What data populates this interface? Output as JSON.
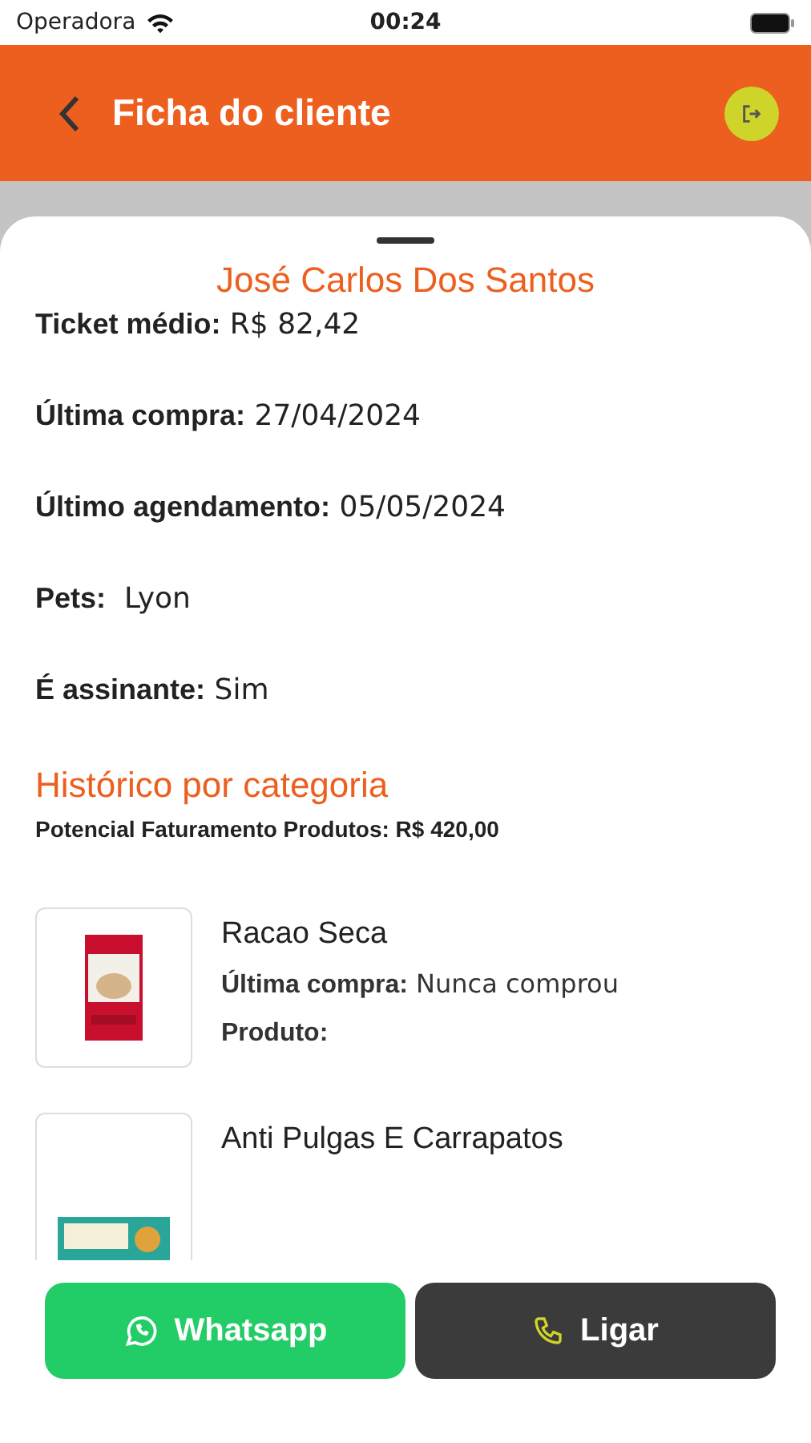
{
  "status_bar": {
    "carrier": "Operadora",
    "time": "00:24"
  },
  "header": {
    "title": "Ficha do cliente"
  },
  "client": {
    "name": "José Carlos Dos Santos",
    "info": [
      {
        "label": "Ticket médio:",
        "value": "R$ 82,42"
      },
      {
        "label": "Última compra:",
        "value": "27/04/2024"
      },
      {
        "label": "Último agendamento:",
        "value": "05/05/2024"
      },
      {
        "label": "Pets:",
        "value": " Lyon"
      },
      {
        "label": "É assinante:",
        "value": "Sim"
      }
    ]
  },
  "history": {
    "title": "Histórico por categoria",
    "potential": {
      "label": "Potencial Faturamento Produtos:",
      "value": "R$ 420,00"
    },
    "products": [
      {
        "name": "Racao Seca",
        "lines": [
          {
            "label": "Última compra:",
            "value": "Nunca comprou"
          },
          {
            "label": "Produto:"
          }
        ]
      },
      {
        "name": "Anti Pulgas E Carrapatos"
      }
    ]
  },
  "actions": [
    {
      "kind": "whatsapp",
      "label": "Whatsapp"
    },
    {
      "kind": "call",
      "label": "Ligar"
    }
  ]
}
